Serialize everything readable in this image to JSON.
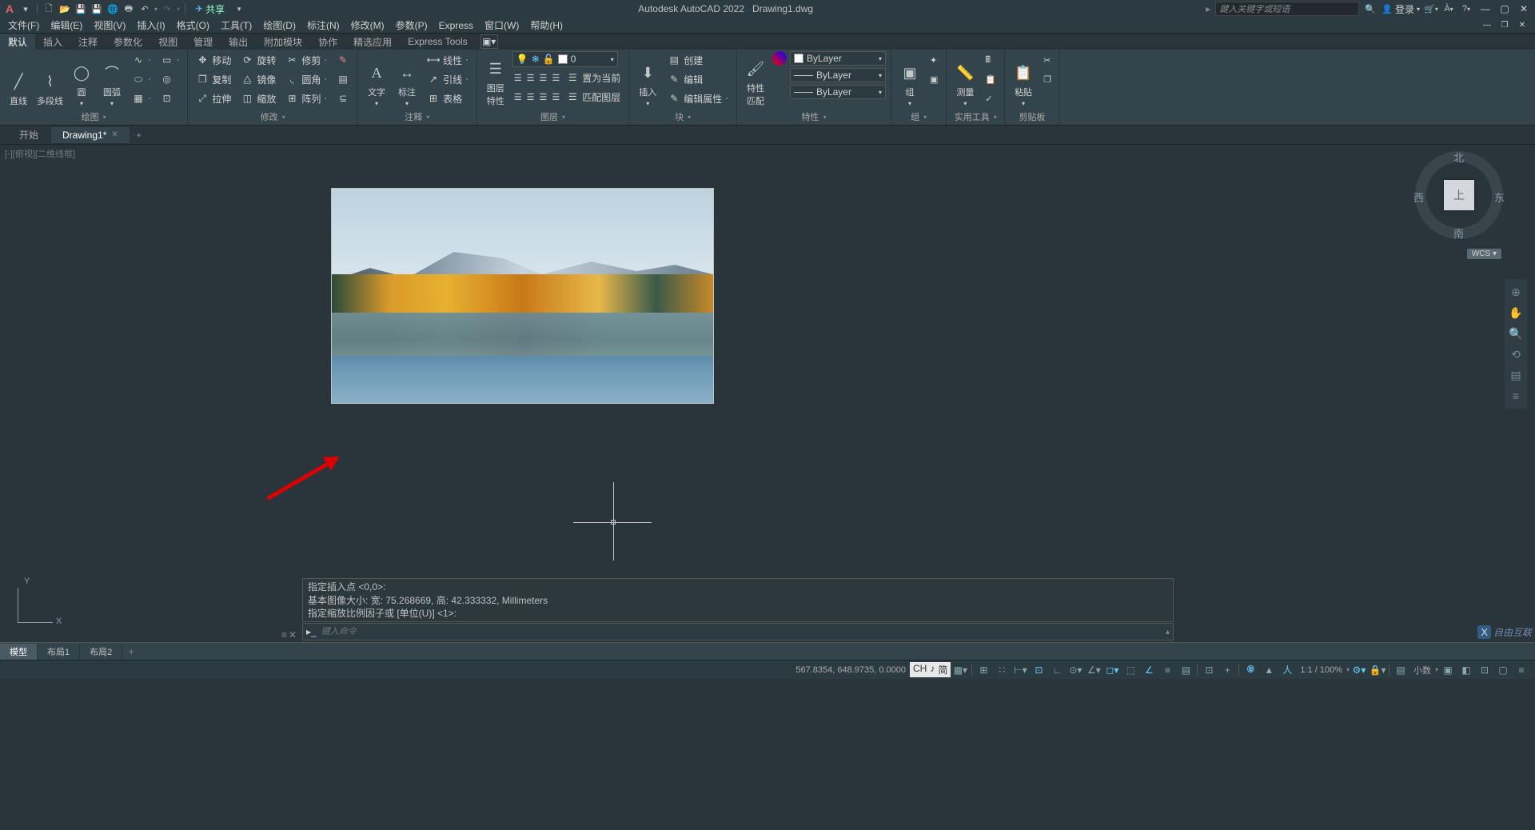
{
  "title": {
    "app": "Autodesk AutoCAD 2022",
    "doc": "Drawing1.dwg"
  },
  "qat": {
    "share": "共享",
    "search_ph": "鍵入关键字或短语",
    "login": "登录"
  },
  "menus": [
    "文件(F)",
    "编辑(E)",
    "视图(V)",
    "插入(I)",
    "格式(O)",
    "工具(T)",
    "绘图(D)",
    "标注(N)",
    "修改(M)",
    "参数(P)",
    "Express",
    "窗口(W)",
    "帮助(H)"
  ],
  "ribtabs": [
    "默认",
    "插入",
    "注释",
    "参数化",
    "视图",
    "管理",
    "输出",
    "附加模块",
    "协作",
    "精选应用",
    "Express Tools"
  ],
  "panel_draw": {
    "label": "绘图",
    "line": "直线",
    "pline": "多段线",
    "circle": "圆",
    "arc": "圆弧"
  },
  "panel_modify": {
    "label": "修改",
    "move": "移动",
    "rotate": "旋转",
    "trim": "修剪",
    "copy": "复制",
    "mirror": "镜像",
    "fillet": "圆角",
    "stretch": "拉伸",
    "scale": "缩放",
    "array": "阵列"
  },
  "panel_annot": {
    "label": "注释",
    "text": "文字",
    "dim": "标注",
    "xianxing": "线性",
    "yinxian": "引线",
    "biaoji": "表格"
  },
  "panel_layer": {
    "label": "图层",
    "props": "图层\n特性",
    "zhiwei": "置为当前",
    "pipei": "匹配图层",
    "val": "0"
  },
  "panel_block": {
    "label": "块",
    "insert": "插入",
    "create": "创建",
    "edit": "编辑",
    "editattr": "编辑属性"
  },
  "panel_props": {
    "label": "特性",
    "match": "特性\n匹配",
    "bylayer": "ByLayer"
  },
  "panel_group": {
    "label": "组",
    "group": "组"
  },
  "panel_util": {
    "label": "实用工具",
    "measure": "测量"
  },
  "panel_clip": {
    "label": "剪贴板",
    "paste": "粘贴"
  },
  "filetabs": {
    "start": "开始",
    "drawing": "Drawing1*"
  },
  "viewport_label": "[-][俯视][二维线框]",
  "viewcube": {
    "top": "上",
    "n": "北",
    "s": "南",
    "e": "东",
    "w": "西",
    "wcs": "WCS ▾"
  },
  "ucs": {
    "x": "X",
    "y": "Y"
  },
  "cmd": {
    "l1": "指定插入点 <0,0>:",
    "l2": "基本图像大小: 宽: 75.268669, 高: 42.333332, Millimeters",
    "l3": "指定缩放比例因子或 [单位(U)] <1>:",
    "ph": "键入命令"
  },
  "layouts": {
    "model": "模型",
    "l1": "布局1",
    "l2": "布局2"
  },
  "status": {
    "coords": "567.8354, 648.9735, 0.0000",
    "ime1": "CH",
    "ime2": "♪",
    "ime3": "简",
    "zoom": "1:1 / 100%",
    "dec": "小数"
  },
  "watermark": "自由互联"
}
